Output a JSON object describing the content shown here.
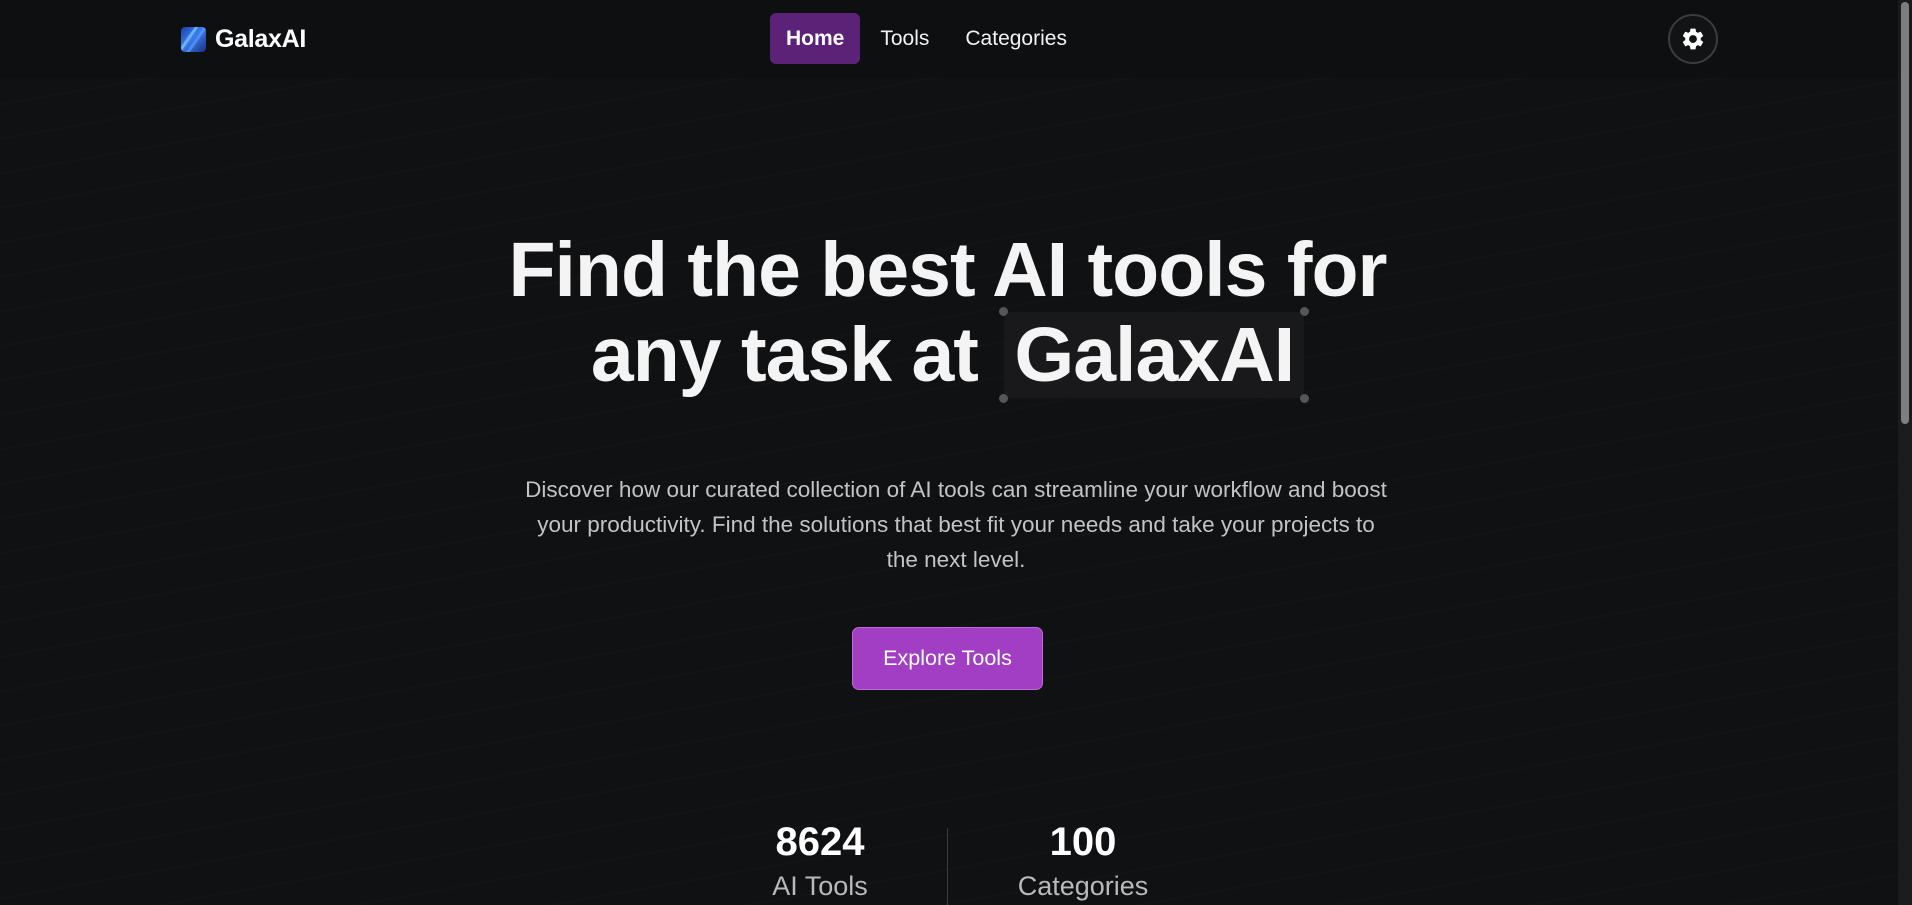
{
  "navbar": {
    "brand": "GalaxAI",
    "brand_logo_icon": "galaxy-logo-icon",
    "links": [
      {
        "label": "Home",
        "active": true
      },
      {
        "label": "Tools",
        "active": false
      },
      {
        "label": "Categories",
        "active": false
      }
    ],
    "settings_icon": "gear-icon"
  },
  "hero": {
    "title_line1": "Find the best AI tools for",
    "title_line2_prefix": "any task at",
    "title_highlight": "GalaxAI",
    "description": "Discover how our curated collection of AI tools can streamline your workflow and boost your productivity. Find the solutions that best fit your needs and take your projects to the next level.",
    "cta_label": "Explore Tools"
  },
  "stats": [
    {
      "value": "8624",
      "label": "AI Tools"
    },
    {
      "value": "100",
      "label": "Categories"
    }
  ],
  "colors": {
    "background": "#101112",
    "accent_active_nav": "#5b2277",
    "accent_button": "#a23ec4",
    "text_primary": "#f4f4f5",
    "text_secondary": "#c3c3c6"
  }
}
